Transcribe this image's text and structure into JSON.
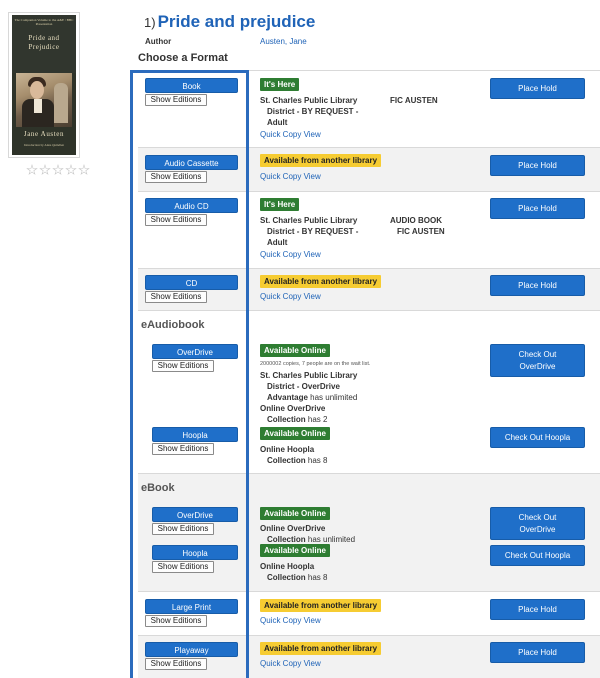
{
  "record": {
    "number": "1)",
    "title": "Pride and prejudice",
    "author_label": "Author",
    "author": "Austen, Jane",
    "choose_format": "Choose a Format",
    "rating_stars": 0
  },
  "cover": {
    "series": "The Companion Volume to the A&E / BBC Presentation",
    "title": "Pride and Prejudice",
    "author": "Jane Austen",
    "intro": "Introduction by Anna Quindlen"
  },
  "common": {
    "show_editions": "Show Editions",
    "place_hold": "Place Hold",
    "quick_copy": "Quick Copy View",
    "its_here": "It's Here",
    "available_other": "Available from another library",
    "available_online": "Available Online"
  },
  "formats": {
    "book": {
      "label": "Book",
      "lines": [
        "St. Charles Public Library",
        "District - BY REQUEST -",
        "Adult"
      ],
      "call_no": "FIC AUSTEN"
    },
    "audio_cassette": {
      "label": "Audio Cassette"
    },
    "audio_cd": {
      "label": "Audio CD",
      "lines": [
        "St. Charles Public Library",
        "District - BY REQUEST -",
        "Adult"
      ],
      "call_no": [
        "AUDIO BOOK",
        "FIC AUSTEN"
      ]
    },
    "cd": {
      "label": "CD"
    },
    "large_print": {
      "label": "Large Print"
    },
    "playaway": {
      "label": "Playaway"
    }
  },
  "eaudiobook": {
    "heading": "eAudiobook",
    "overdrive": {
      "label": "OverDrive",
      "copies_note": "2000002 copies, 7 people are on the wait list.",
      "lines": [
        [
          "St. Charles Public Library",
          ""
        ],
        [
          "District - OverDrive",
          ""
        ],
        [
          "Advantage",
          " has unlimited"
        ],
        [
          "Online OverDrive",
          ""
        ],
        [
          "Collection",
          " has 2"
        ]
      ],
      "action": "Check Out OverDrive"
    },
    "hoopla": {
      "label": "Hoopla",
      "lines": [
        [
          "Online Hoopla",
          ""
        ],
        [
          "Collection",
          " has 8"
        ]
      ],
      "action": "Check Out Hoopla"
    }
  },
  "ebook": {
    "heading": "eBook",
    "overdrive": {
      "label": "OverDrive",
      "lines": [
        [
          "Online OverDrive",
          ""
        ],
        [
          "Collection",
          " has unlimited"
        ]
      ],
      "action": "Check Out OverDrive"
    },
    "hoopla": {
      "label": "Hoopla",
      "lines": [
        [
          "Online Hoopla",
          ""
        ],
        [
          "Collection",
          " has 8"
        ]
      ],
      "action": "Check Out Hoopla"
    }
  },
  "colors": {
    "accent": "#1f6fc9",
    "link": "#1f63b7",
    "green": "#2e7d32",
    "yellow": "#f6cc32",
    "highlight": "#2b6bbd"
  }
}
